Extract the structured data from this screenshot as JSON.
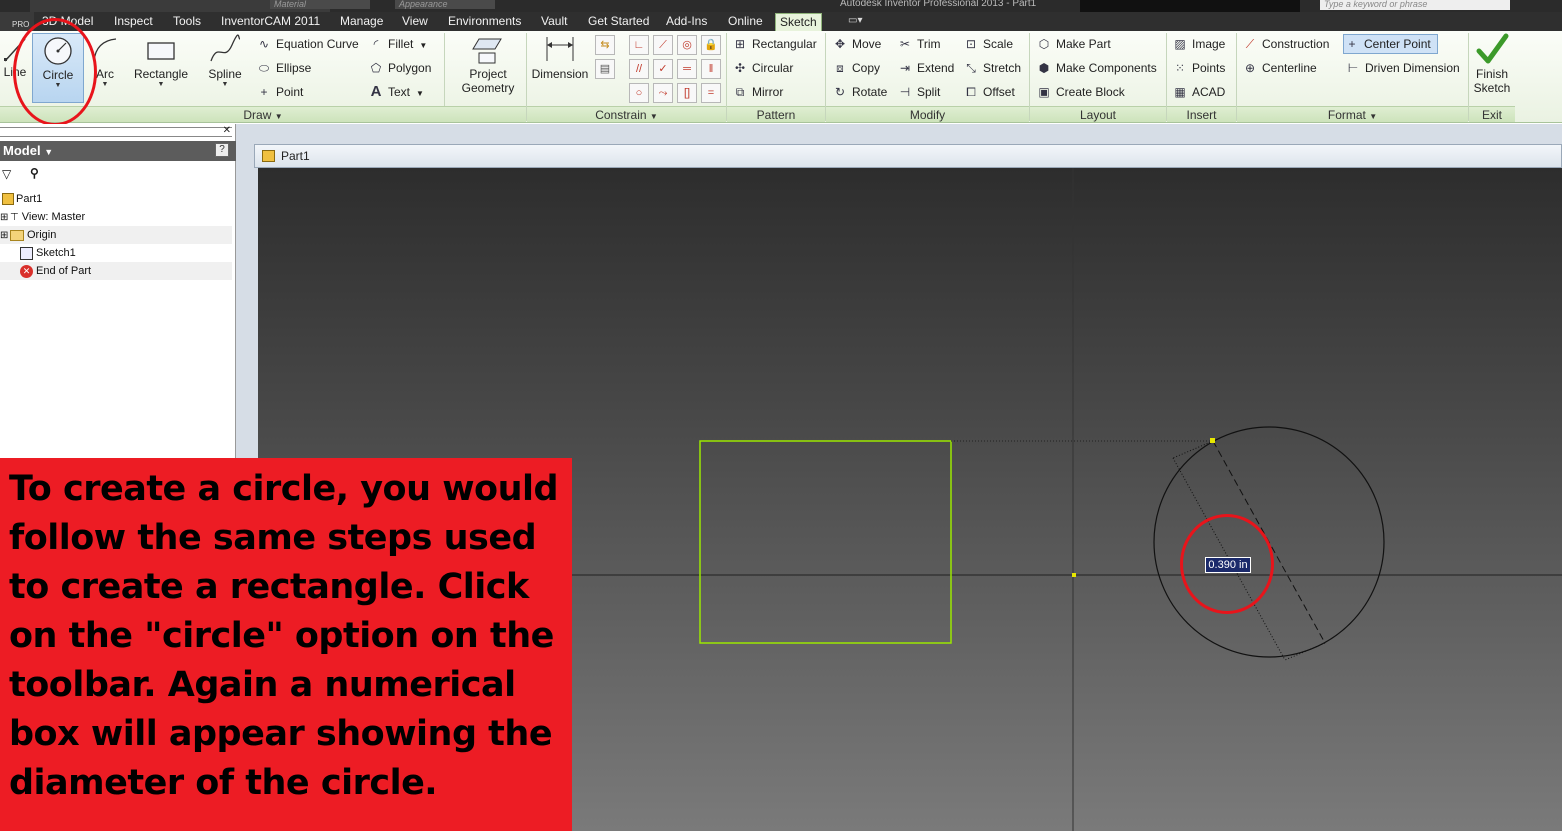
{
  "titlebar": {
    "material_placeholder": "Material",
    "appearance_placeholder": "Appearance",
    "app_title": "Autodesk Inventor Professional 2013 - Part1",
    "search_placeholder": "Type a keyword or phrase",
    "pro_badge": "PRO"
  },
  "menu_tabs": [
    {
      "label": "3D Model"
    },
    {
      "label": "Inspect"
    },
    {
      "label": "Tools"
    },
    {
      "label": "InventorCAM 2011"
    },
    {
      "label": "Manage"
    },
    {
      "label": "View"
    },
    {
      "label": "Environments"
    },
    {
      "label": "Vault"
    },
    {
      "label": "Get Started"
    },
    {
      "label": "Add-Ins"
    },
    {
      "label": "Online"
    },
    {
      "label": "Sketch",
      "active": true
    }
  ],
  "ribbon": {
    "draw": {
      "title": "Draw",
      "line": "Line",
      "circle": "Circle",
      "arc": "Arc",
      "rectangle": "Rectangle",
      "spline": "Spline",
      "equation_curve": "Equation Curve",
      "ellipse": "Ellipse",
      "point": "Point",
      "fillet": "Fillet",
      "polygon": "Polygon",
      "text": "Text",
      "project_geometry_1": "Project",
      "project_geometry_2": "Geometry"
    },
    "constrain": {
      "title": "Constrain",
      "dimension": "Dimension"
    },
    "pattern": {
      "title": "Pattern",
      "rectangular": "Rectangular",
      "circular": "Circular",
      "mirror": "Mirror"
    },
    "modify": {
      "title": "Modify",
      "move": "Move",
      "copy": "Copy",
      "rotate": "Rotate",
      "trim": "Trim",
      "extend": "Extend",
      "split": "Split",
      "scale": "Scale",
      "stretch": "Stretch",
      "offset": "Offset"
    },
    "layout": {
      "title": "Layout",
      "make_part": "Make Part",
      "make_components": "Make Components",
      "create_block": "Create Block"
    },
    "insert": {
      "title": "Insert",
      "image": "Image",
      "points": "Points",
      "acad": "ACAD"
    },
    "format": {
      "title": "Format",
      "construction": "Construction",
      "centerline": "Centerline",
      "center_point": "Center Point",
      "driven_dimension": "Driven Dimension"
    },
    "exit": {
      "title": "Exit",
      "finish_1": "Finish",
      "finish_2": "Sketch"
    }
  },
  "browser": {
    "header": "Model",
    "help": "?",
    "tree": [
      {
        "label": "Part1"
      },
      {
        "label": "View: Master"
      },
      {
        "label": "Origin"
      },
      {
        "label": "Sketch1"
      },
      {
        "label": "End of Part"
      }
    ]
  },
  "document": {
    "tab": "Part1"
  },
  "canvas": {
    "dimension_value": "0.390 in"
  },
  "callout": {
    "text": "To create a circle, you would follow the same steps used to create a rectangle. Click on the \"circle\" option on the toolbar. Again a numerical box will appear showing the diameter of the circle."
  }
}
